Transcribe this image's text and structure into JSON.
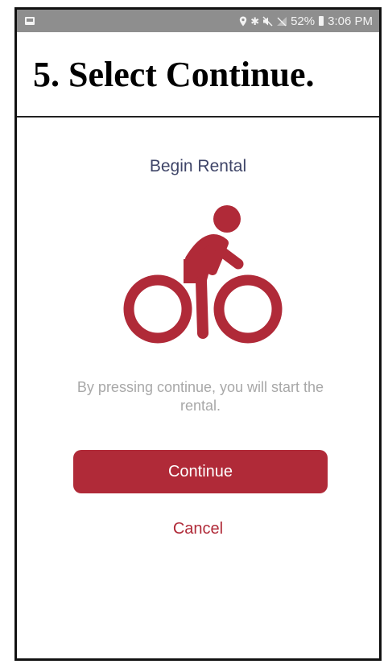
{
  "status_bar": {
    "icons": [
      "image-notification-icon",
      "location-icon",
      "bluetooth-icon",
      "mute-icon",
      "signal-icon",
      "battery-icon"
    ],
    "battery": "52%",
    "time": "3:06 PM"
  },
  "instruction": {
    "text": "5. Select Continue."
  },
  "screen": {
    "title": "Begin Rental",
    "icon": "bicycle-rider-icon",
    "message": "By pressing continue, you will start the rental.",
    "continue_label": "Continue",
    "cancel_label": "Cancel"
  },
  "colors": {
    "accent": "#b02a38",
    "title": "#3f4568",
    "message": "#a8a8a8",
    "status_bar": "#8e8e8e"
  }
}
